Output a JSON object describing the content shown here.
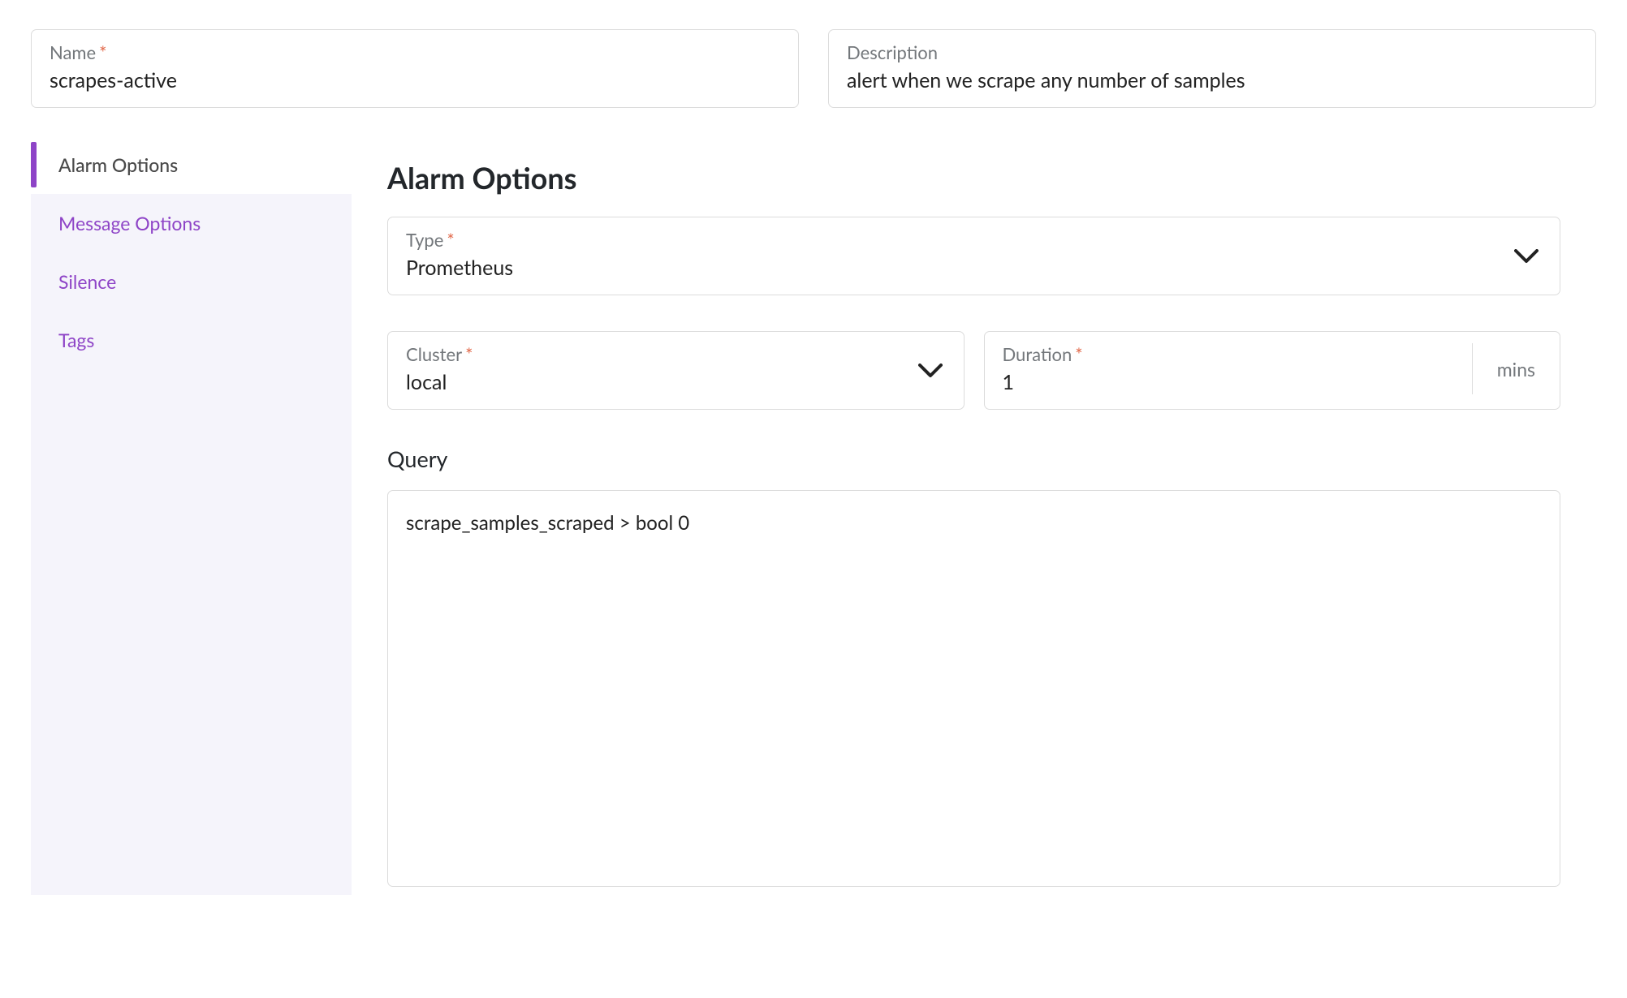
{
  "header": {
    "name_label": "Name",
    "name_value": "scrapes-active",
    "description_label": "Description",
    "description_value": "alert when we scrape any number of samples"
  },
  "sidebar": {
    "tabs": [
      {
        "label": "Alarm Options",
        "active": true
      },
      {
        "label": "Message Options",
        "active": false
      },
      {
        "label": "Silence",
        "active": false
      },
      {
        "label": "Tags",
        "active": false
      }
    ]
  },
  "content": {
    "heading": "Alarm Options",
    "type_label": "Type",
    "type_value": "Prometheus",
    "cluster_label": "Cluster",
    "cluster_value": "local",
    "duration_label": "Duration",
    "duration_value": "1",
    "duration_unit": "mins",
    "query_label": "Query",
    "query_value": "scrape_samples_scraped > bool 0"
  },
  "required_marker": "*"
}
